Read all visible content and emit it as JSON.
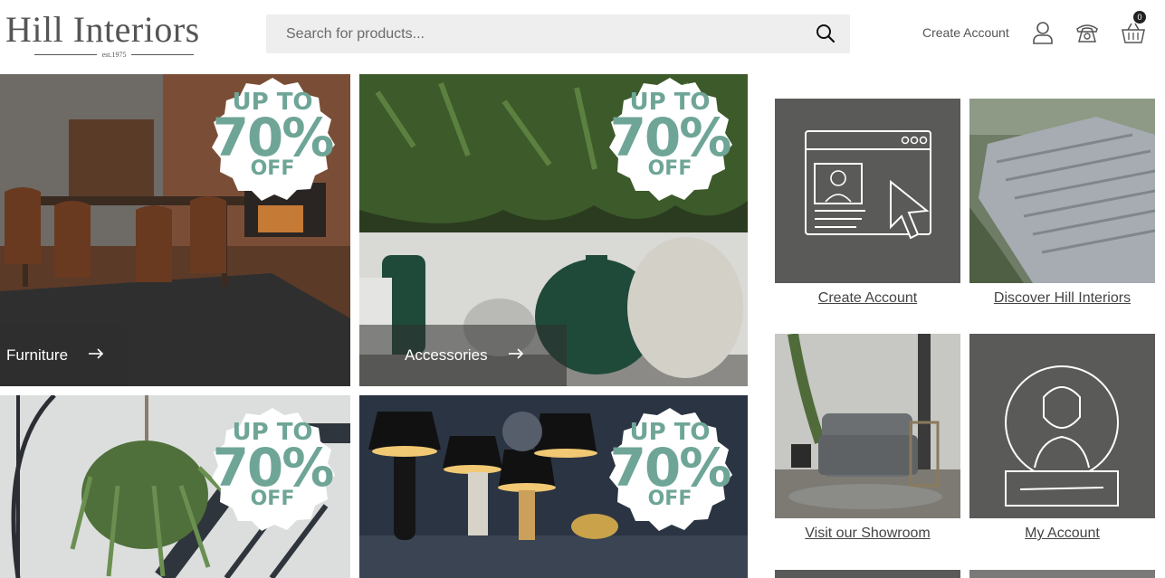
{
  "header": {
    "logo_text": "Hill Interiors",
    "logo_sub": "est.1975",
    "search_placeholder": "Search for products...",
    "create_account": "Create Account",
    "basket_count": "0"
  },
  "categories": [
    {
      "label": "Furniture",
      "badge_l1": "UP TO",
      "badge_l2": "70%",
      "badge_l3": "OFF"
    },
    {
      "label": "Accessories",
      "badge_l1": "UP TO",
      "badge_l2": "70%",
      "badge_l3": "OFF"
    },
    {
      "label": "",
      "badge_l1": "UP TO",
      "badge_l2": "70%",
      "badge_l3": "OFF"
    },
    {
      "label": "",
      "badge_l1": "UP TO",
      "badge_l2": "70%",
      "badge_l3": "OFF"
    }
  ],
  "cards": [
    {
      "label": "Create Account"
    },
    {
      "label": "Discover Hill Interiors"
    },
    {
      "label": "Visit our Showroom"
    },
    {
      "label": "My Account"
    }
  ],
  "colors": {
    "badge_text": "#6ea597",
    "card_bg": "#5a5a58",
    "search_bg": "#eeeeee"
  }
}
